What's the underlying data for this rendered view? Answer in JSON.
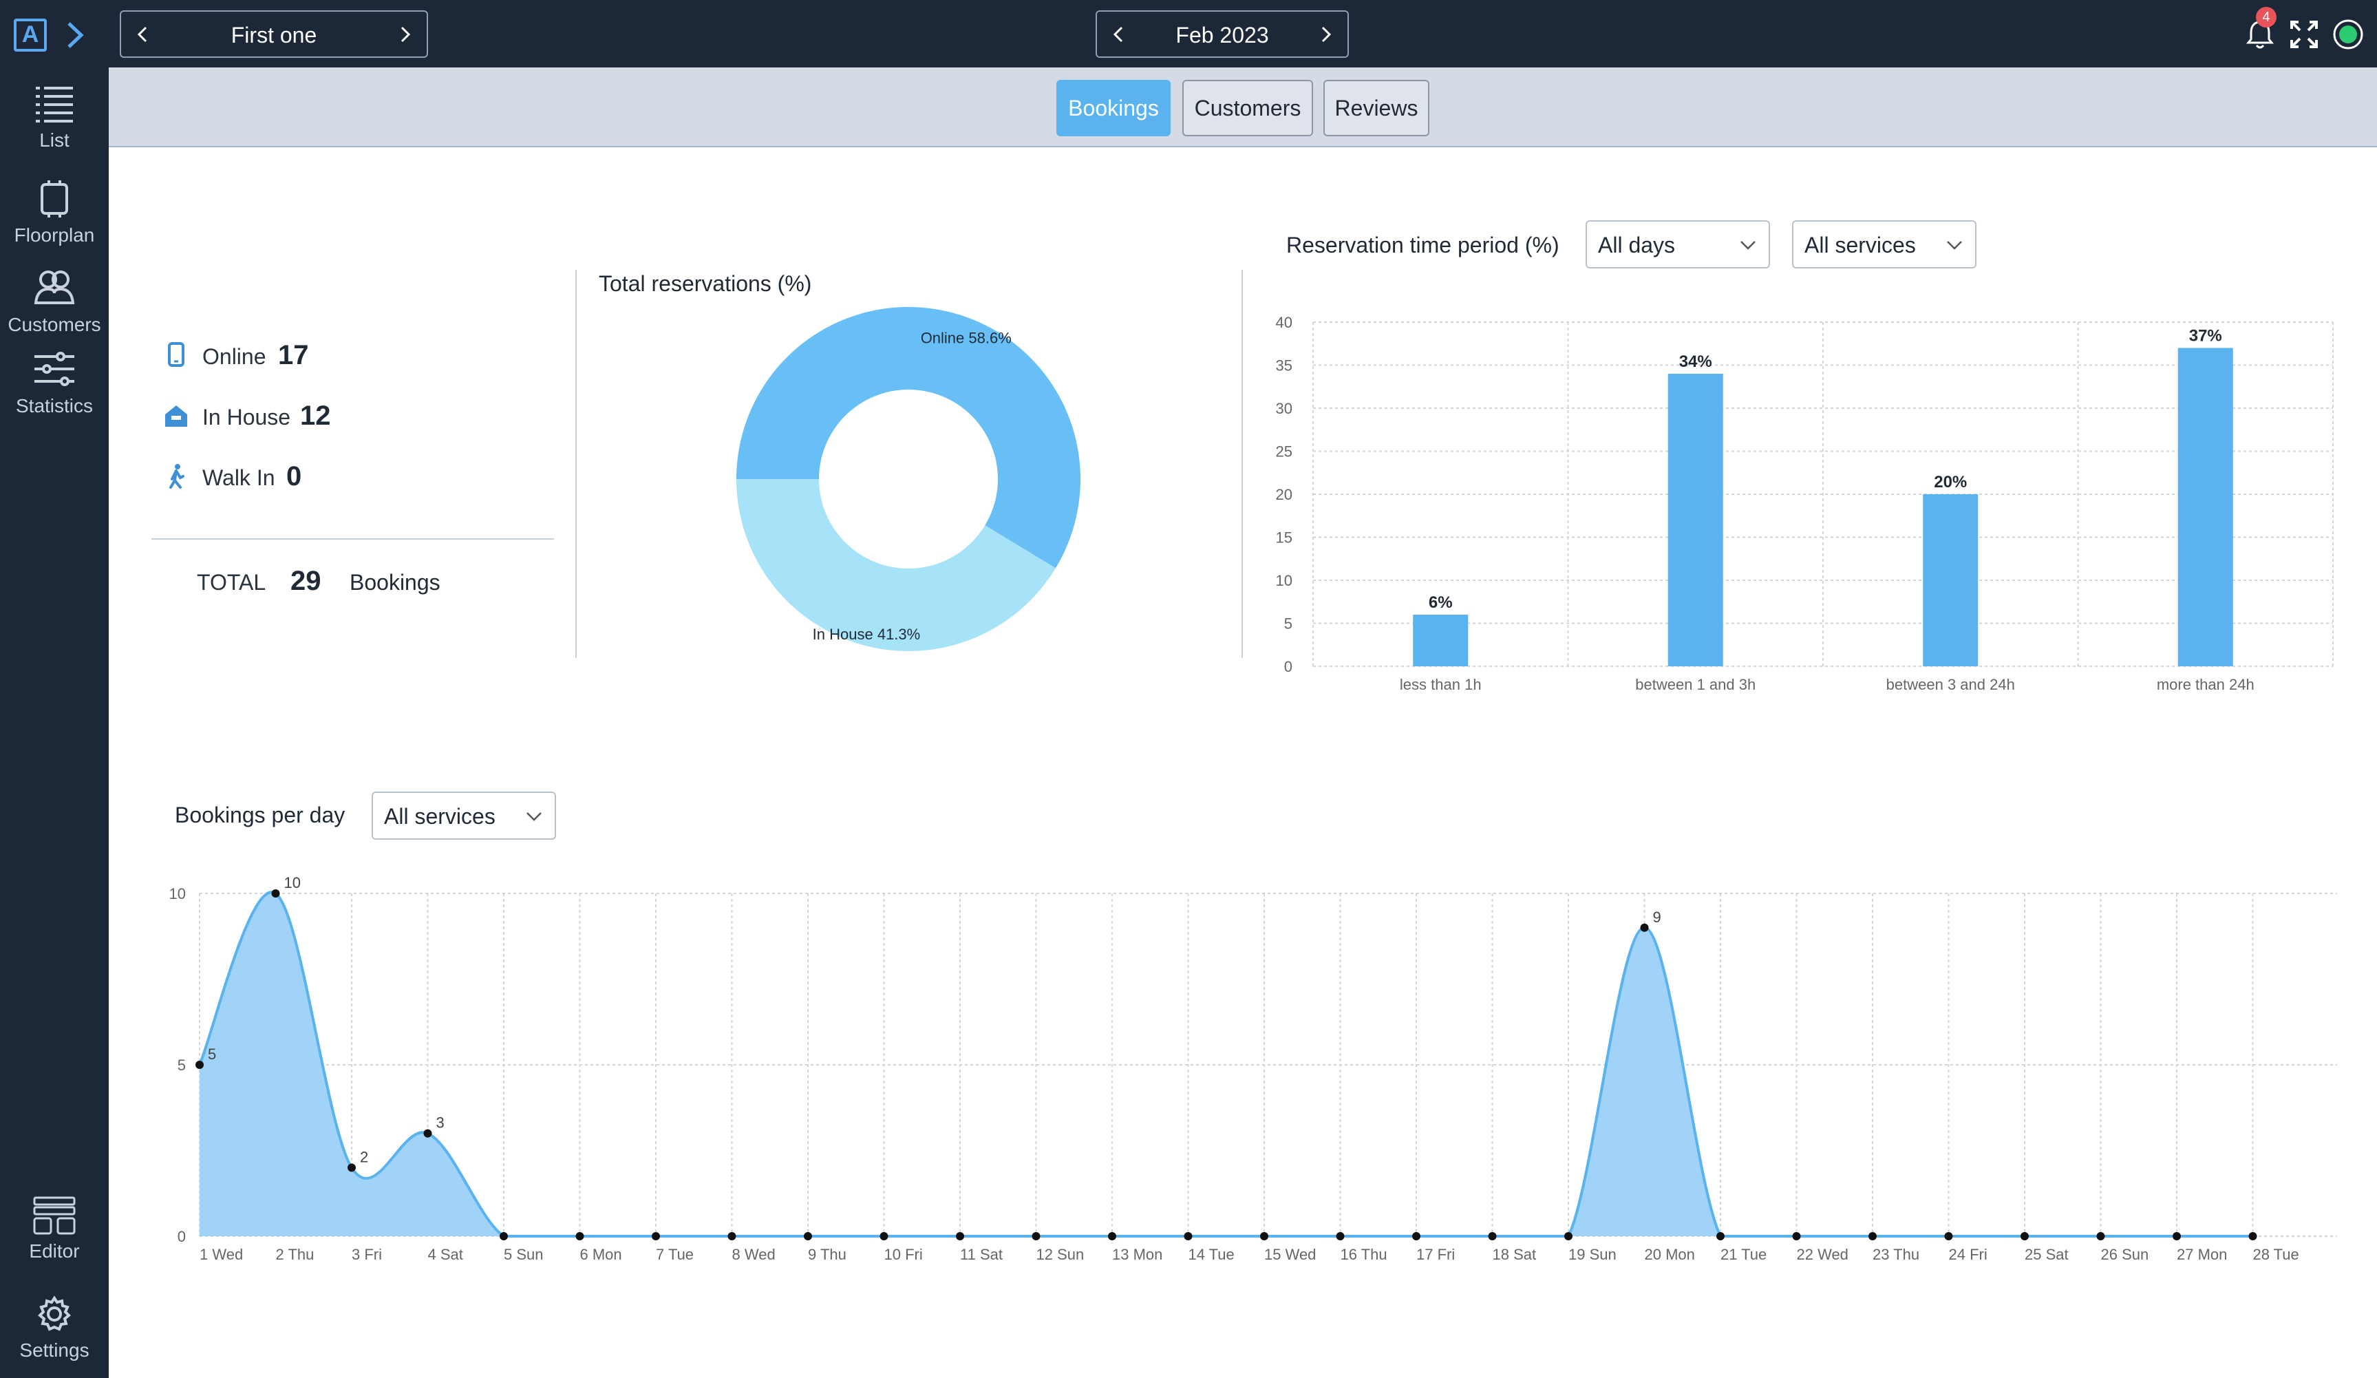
{
  "topbar": {
    "logo_letter": "A",
    "location": "First one",
    "period": "Feb 2023",
    "notification_count": "4"
  },
  "sidebar": {
    "items": [
      {
        "label": "List",
        "icon": "list-icon"
      },
      {
        "label": "Floorplan",
        "icon": "floorplan-icon"
      },
      {
        "label": "Customers",
        "icon": "customers-icon"
      },
      {
        "label": "Statistics",
        "icon": "statistics-icon"
      },
      {
        "label": "Editor",
        "icon": "editor-icon"
      },
      {
        "label": "Settings",
        "icon": "settings-icon"
      }
    ]
  },
  "tabs": [
    {
      "label": "Bookings",
      "active": true
    },
    {
      "label": "Customers",
      "active": false
    },
    {
      "label": "Reviews",
      "active": false
    }
  ],
  "stats": {
    "online_label": "Online",
    "online_value": "17",
    "inhouse_label": "In House",
    "inhouse_value": "12",
    "walkin_label": "Walk In",
    "walkin_value": "0",
    "total_label": "TOTAL",
    "total_value": "29",
    "total_unit": "Bookings"
  },
  "filters": {
    "days": "All days",
    "services_time": "All services",
    "services_day": "All services"
  },
  "colors": {
    "accent": "#5ab3ee",
    "sidebar_bg": "#1c2838",
    "online_slice": "#68bff5",
    "inhouse_slice": "#a6e2f8",
    "notification": "#e8545a",
    "status_online": "#2ecc71"
  },
  "chart_data": [
    {
      "type": "pie",
      "title": "Total reservations (%)",
      "categories": [
        "Online",
        "In House"
      ],
      "values": [
        58.6,
        41.3
      ],
      "labels": [
        "Online 58.6%",
        "In House 41.3%"
      ]
    },
    {
      "type": "bar",
      "title": "Reservation time period (%)",
      "categories": [
        "less than 1h",
        "between 1 and 3h",
        "between 3 and 24h",
        "more than 24h"
      ],
      "values": [
        6,
        34,
        20,
        37
      ],
      "value_labels": [
        "6%",
        "34%",
        "20%",
        "37%"
      ],
      "ylim": [
        0,
        40
      ],
      "yticks": [
        "0",
        "5",
        "10",
        "15",
        "20",
        "25",
        "30",
        "35",
        "40"
      ],
      "grid": true
    },
    {
      "type": "area",
      "title": "Bookings per day",
      "x": [
        "1 Wed",
        "2 Thu",
        "3 Fri",
        "4 Sat",
        "5 Sun",
        "6 Mon",
        "7 Tue",
        "8 Wed",
        "9 Thu",
        "10 Fri",
        "11 Sat",
        "12 Sun",
        "13 Mon",
        "14 Tue",
        "15 Wed",
        "16 Thu",
        "17 Fri",
        "18 Sat",
        "19 Sun",
        "20 Mon",
        "21 Tue",
        "22 Wed",
        "23 Thu",
        "24 Fri",
        "25 Sat",
        "26 Sun",
        "27 Mon",
        "28 Tue"
      ],
      "values": [
        5,
        10,
        2,
        3,
        0,
        0,
        0,
        0,
        0,
        0,
        0,
        0,
        0,
        0,
        0,
        0,
        0,
        0,
        0,
        9,
        0,
        0,
        0,
        0,
        0,
        0,
        0,
        0
      ],
      "point_labels": [
        "5",
        "10",
        "2",
        "3",
        "",
        "",
        "",
        "",
        "",
        "",
        "",
        "",
        "",
        "",
        "",
        "",
        "",
        "",
        "",
        "9",
        "",
        "",
        "",
        "",
        "",
        "",
        "",
        ""
      ],
      "ylim": [
        0,
        10
      ],
      "yticks": [
        "0",
        "5",
        "10"
      ],
      "grid": true
    }
  ]
}
